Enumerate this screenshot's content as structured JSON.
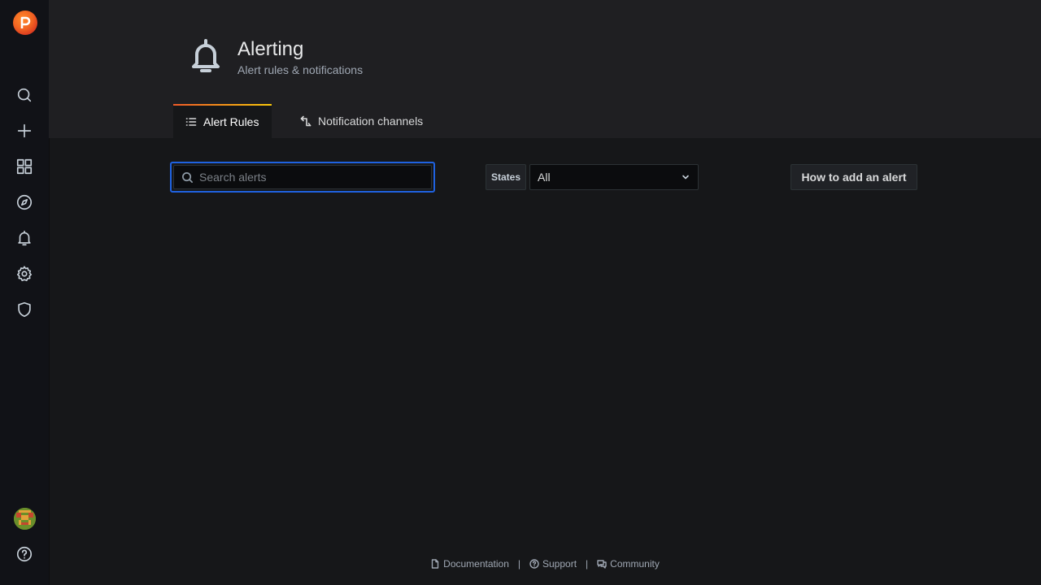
{
  "header": {
    "title": "Alerting",
    "subtitle": "Alert rules & notifications",
    "icon": "bell-icon"
  },
  "tabs": [
    {
      "label": "Alert Rules",
      "icon": "list-icon",
      "active": true
    },
    {
      "label": "Notification channels",
      "icon": "channel-icon",
      "active": false
    }
  ],
  "toolbar": {
    "search_placeholder": "Search alerts",
    "search_value": "",
    "states_label": "States",
    "states_value": "All",
    "howto_label": "How to add an alert"
  },
  "sidebar": {
    "items": [
      {
        "name": "search-icon"
      },
      {
        "name": "plus-icon"
      },
      {
        "name": "dashboards-icon"
      },
      {
        "name": "explore-icon"
      },
      {
        "name": "alerting-icon"
      },
      {
        "name": "configuration-icon"
      },
      {
        "name": "shield-icon"
      }
    ],
    "bottom": [
      {
        "name": "avatar"
      },
      {
        "name": "help-icon"
      }
    ]
  },
  "footer": {
    "links": [
      {
        "label": "Documentation",
        "icon": "document-icon"
      },
      {
        "label": "Support",
        "icon": "question-icon"
      },
      {
        "label": "Community",
        "icon": "comments-icon"
      }
    ],
    "separator": "|"
  },
  "colors": {
    "accent_focus": "#1f62e0",
    "tab_gradient_start": "#f05a28",
    "tab_gradient_end": "#fbca0a",
    "logo": "#f26522"
  }
}
